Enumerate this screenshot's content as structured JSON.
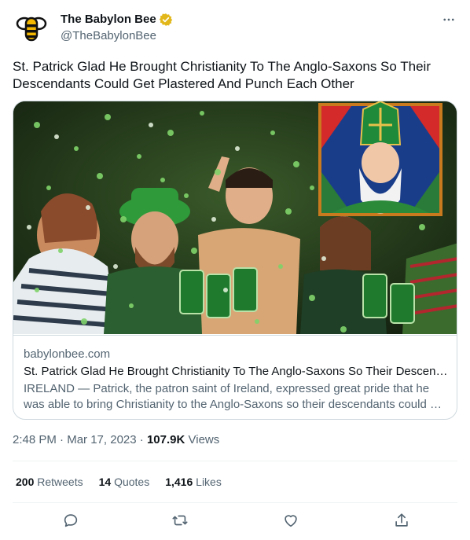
{
  "author": {
    "display_name": "The Babylon Bee",
    "handle": "@TheBabylonBee",
    "verified_badge": "gold-verified-icon",
    "avatar": "babylon-bee-logo"
  },
  "tweet": {
    "text": "St. Patrick Glad He Brought Christianity To The Anglo-Saxons So Their Descendants Could Get Plastered And Punch Each Other"
  },
  "card": {
    "image": "st-patricks-party-photo",
    "inset_image": "st-patrick-stained-glass",
    "domain": "babylonbee.com",
    "title": "St. Patrick Glad He Brought Christianity To The Anglo-Saxons So Their Descendants Could Get Plastered And Punch Each Other",
    "description": "IRELAND — Patrick, the patron saint of Ireland, expressed great pride that he was able to bring Christianity to the Anglo-Saxons so their descendants could get plastered and punch each other."
  },
  "meta": {
    "time": "2:48 PM",
    "separator": "·",
    "date": "Mar 17, 2023",
    "views_count": "107.9K",
    "views_label": "Views"
  },
  "stats": {
    "retweets_count": "200",
    "retweets_label": "Retweets",
    "quotes_count": "14",
    "quotes_label": "Quotes",
    "likes_count": "1,416",
    "likes_label": "Likes"
  },
  "actions": [
    "reply-icon",
    "retweet-icon",
    "like-icon",
    "share-icon"
  ],
  "colors": {
    "text_primary": "#0f1419",
    "text_secondary": "#536471",
    "border": "#cfd9de",
    "divider": "#eff3f4",
    "verified_gold": "#e2b719",
    "bee_yellow": "#f5b800",
    "icon": "#536471"
  }
}
